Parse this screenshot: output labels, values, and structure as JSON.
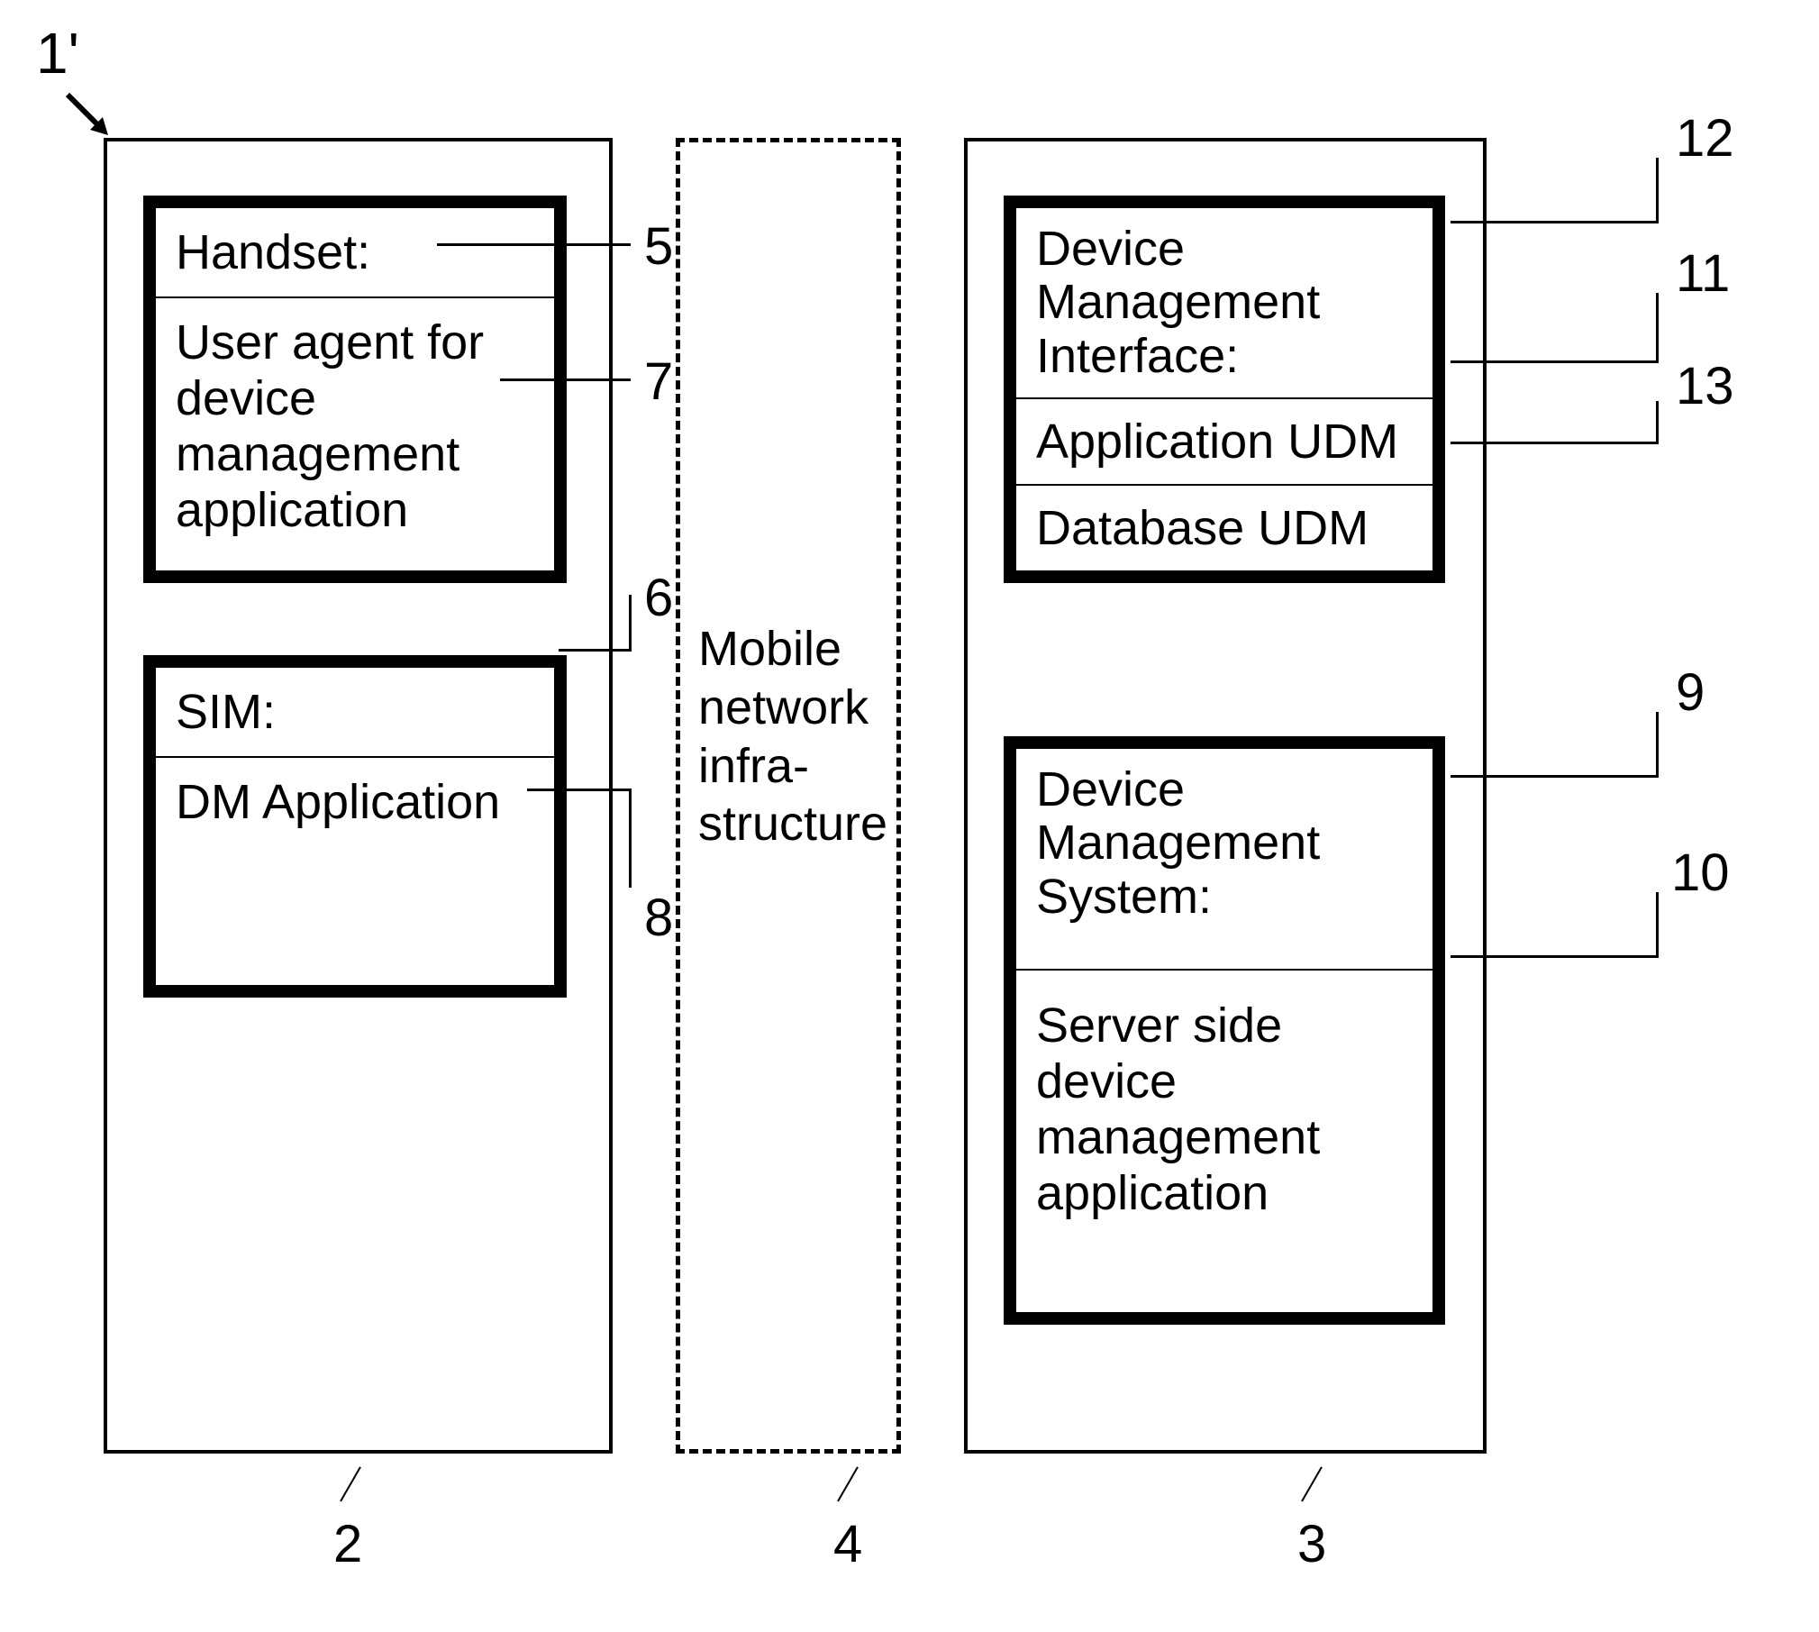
{
  "top_label": "1'",
  "left_col": {
    "handset": {
      "title": "Handset:",
      "body": "User agent for device management application"
    },
    "sim": {
      "title": "SIM:",
      "body": "DM Application"
    }
  },
  "mid_col": {
    "text": "Mobile network infra-structure"
  },
  "right_col": {
    "dmi": {
      "row1": "Device Management Interface:",
      "row2": "Application UDM",
      "row3": "Database UDM"
    },
    "dms": {
      "title": "Device Management System:",
      "body": "Server side device management application"
    }
  },
  "callouts": {
    "n2": "2",
    "n3": "3",
    "n4": "4",
    "n5": "5",
    "n6": "6",
    "n7": "7",
    "n8": "8",
    "n9": "9",
    "n10": "10",
    "n11": "11",
    "n12": "12",
    "n13": "13"
  }
}
